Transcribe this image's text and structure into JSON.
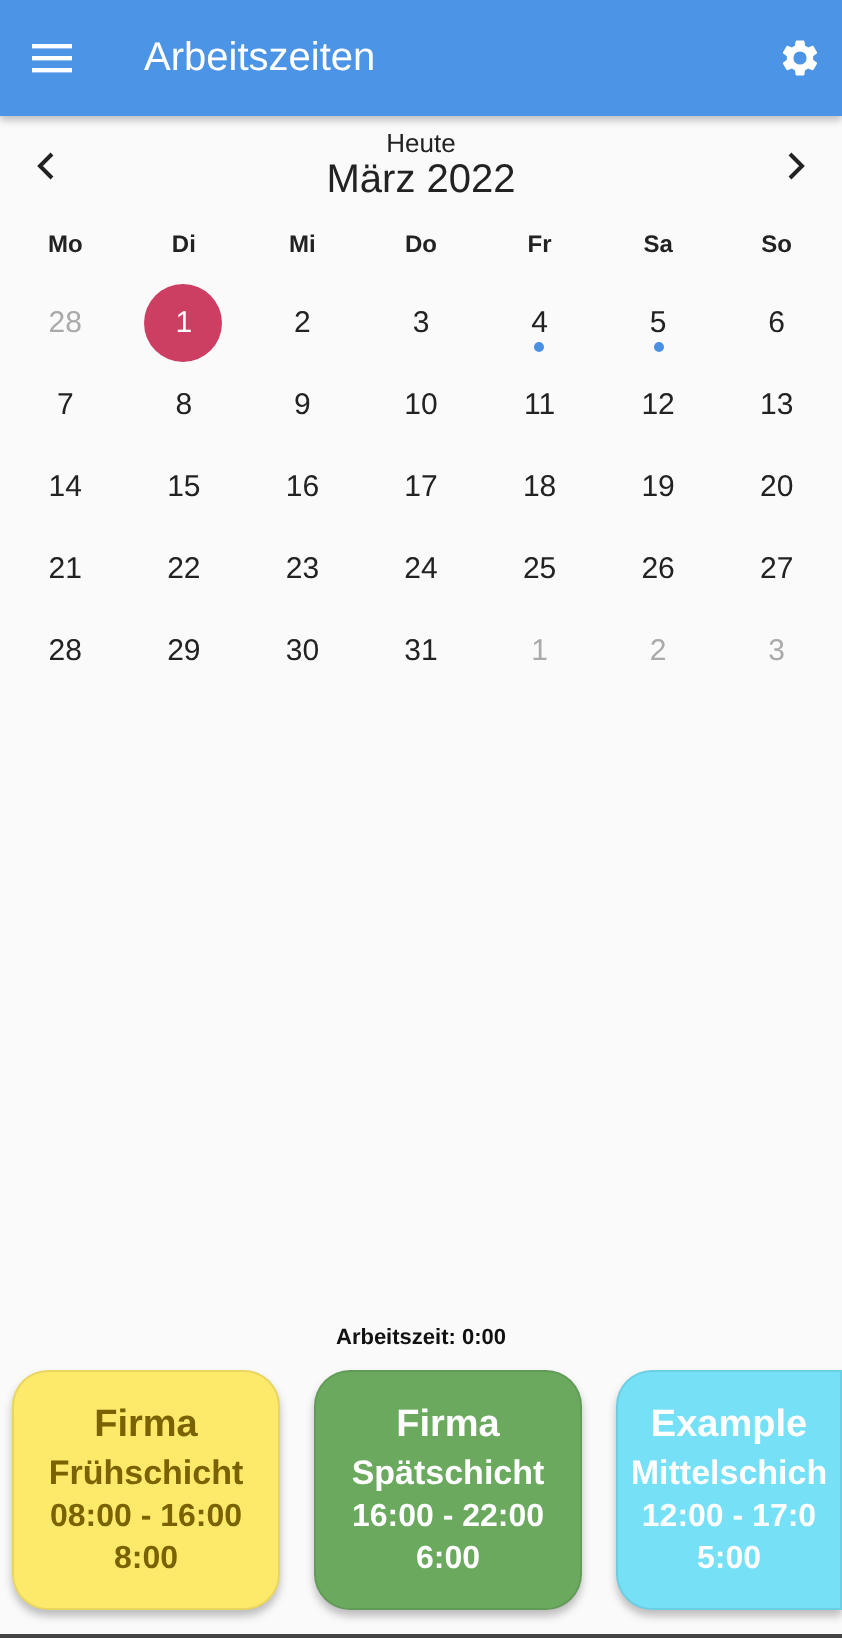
{
  "app_bar": {
    "title": "Arbeitszeiten"
  },
  "calendar": {
    "caption": "Heute",
    "month": "März 2022",
    "weekdays": [
      "Mo",
      "Di",
      "Mi",
      "Do",
      "Fr",
      "Sa",
      "So"
    ],
    "days": [
      {
        "label": "28",
        "outside": true,
        "selected": false,
        "has_event": false
      },
      {
        "label": "1",
        "outside": false,
        "selected": true,
        "has_event": false
      },
      {
        "label": "2",
        "outside": false,
        "selected": false,
        "has_event": false
      },
      {
        "label": "3",
        "outside": false,
        "selected": false,
        "has_event": false
      },
      {
        "label": "4",
        "outside": false,
        "selected": false,
        "has_event": true
      },
      {
        "label": "5",
        "outside": false,
        "selected": false,
        "has_event": true
      },
      {
        "label": "6",
        "outside": false,
        "selected": false,
        "has_event": false
      },
      {
        "label": "7",
        "outside": false,
        "selected": false,
        "has_event": false
      },
      {
        "label": "8",
        "outside": false,
        "selected": false,
        "has_event": false
      },
      {
        "label": "9",
        "outside": false,
        "selected": false,
        "has_event": false
      },
      {
        "label": "10",
        "outside": false,
        "selected": false,
        "has_event": false
      },
      {
        "label": "11",
        "outside": false,
        "selected": false,
        "has_event": false
      },
      {
        "label": "12",
        "outside": false,
        "selected": false,
        "has_event": false
      },
      {
        "label": "13",
        "outside": false,
        "selected": false,
        "has_event": false
      },
      {
        "label": "14",
        "outside": false,
        "selected": false,
        "has_event": false
      },
      {
        "label": "15",
        "outside": false,
        "selected": false,
        "has_event": false
      },
      {
        "label": "16",
        "outside": false,
        "selected": false,
        "has_event": false
      },
      {
        "label": "17",
        "outside": false,
        "selected": false,
        "has_event": false
      },
      {
        "label": "18",
        "outside": false,
        "selected": false,
        "has_event": false
      },
      {
        "label": "19",
        "outside": false,
        "selected": false,
        "has_event": false
      },
      {
        "label": "20",
        "outside": false,
        "selected": false,
        "has_event": false
      },
      {
        "label": "21",
        "outside": false,
        "selected": false,
        "has_event": false
      },
      {
        "label": "22",
        "outside": false,
        "selected": false,
        "has_event": false
      },
      {
        "label": "23",
        "outside": false,
        "selected": false,
        "has_event": false
      },
      {
        "label": "24",
        "outside": false,
        "selected": false,
        "has_event": false
      },
      {
        "label": "25",
        "outside": false,
        "selected": false,
        "has_event": false
      },
      {
        "label": "26",
        "outside": false,
        "selected": false,
        "has_event": false
      },
      {
        "label": "27",
        "outside": false,
        "selected": false,
        "has_event": false
      },
      {
        "label": "28",
        "outside": false,
        "selected": false,
        "has_event": false
      },
      {
        "label": "29",
        "outside": false,
        "selected": false,
        "has_event": false
      },
      {
        "label": "30",
        "outside": false,
        "selected": false,
        "has_event": false
      },
      {
        "label": "31",
        "outside": false,
        "selected": false,
        "has_event": false
      },
      {
        "label": "1",
        "outside": true,
        "selected": false,
        "has_event": false
      },
      {
        "label": "2",
        "outside": true,
        "selected": false,
        "has_event": false
      },
      {
        "label": "3",
        "outside": true,
        "selected": false,
        "has_event": false
      }
    ]
  },
  "work_time": "Arbeitszeit: 0:00",
  "shifts": [
    {
      "company": "Firma",
      "name": "Frühschicht",
      "time": "08:00 - 16:00",
      "duration": "8:00",
      "color": "#fde96a"
    },
    {
      "company": "Firma",
      "name": "Spätschicht",
      "time": "16:00 - 22:00",
      "duration": "6:00",
      "color": "#6ba95f"
    },
    {
      "company": "Example",
      "name": "Mittelschich",
      "time": "12:00 - 17:0",
      "duration": "5:00",
      "color": "#75e0f6"
    }
  ]
}
